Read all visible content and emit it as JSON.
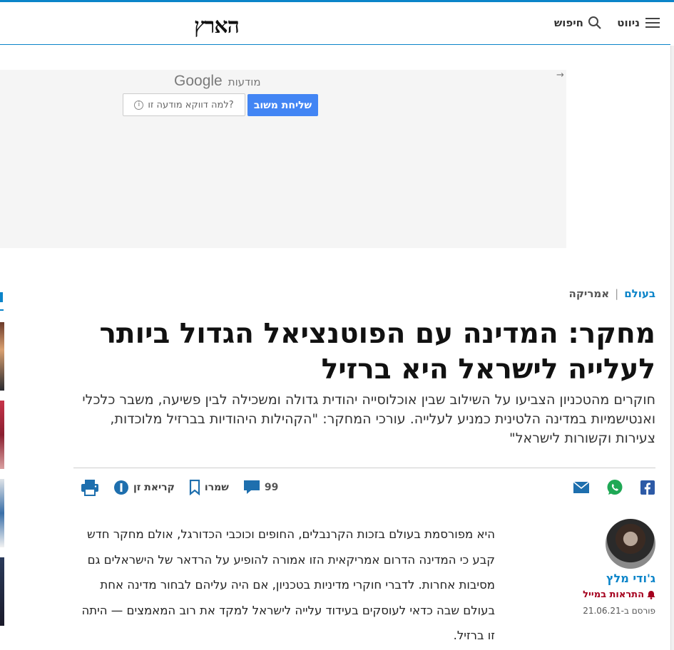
{
  "header": {
    "menu_label": "ניווט",
    "search_label": "חיפוש",
    "logo_text": "הארץ",
    "accent_color": "#0b84c9"
  },
  "ad": {
    "google_label": "Google",
    "ads_label": "מודעות",
    "send_feedback": "שליחת משוב",
    "why_this_ad": "?למה דווקא מודעה זו",
    "arrow_icon": "arrow-right-icon"
  },
  "article": {
    "breadcrumb": [
      "בעולם",
      "אמריקה"
    ],
    "title": "מחקר: המדינה עם הפוטנציאל הגדול ביותר לעלייה לישראל היא ברזיל",
    "subtitle": "חוקרים מהטכניון הצביעו על השילוב שבין אוכלוסייה יהודית גדולה ומשכילה לבין פשיעה, משבר כלכלי ואנטישמיות במדינה הלטינית כמניע לעלייה. עורכי המחקר: \"הקהילות היהודיות בברזיל מלוכדות, צעירות וקשורות לישראל\"",
    "body": "היא מפורסמת בעולם בזכות הקרנבלים, החופים וכוכבי הכדורגל, אולם מחקר חדש קבע כי המדינה הדרום אמריקאית הזו אמורה להופיע על הרדאר של הישראלים גם מסיבות אחרות. לדברי חוקרי מדיניות בטכניון, אם היה עליהם לבחור מדינה אחת בעולם שבה כדאי לעוסקים בעידוד עלייה לישראל למקד את רוב המאמצים — היתה זו ברזיל."
  },
  "toolbar": {
    "comments_count": "99",
    "save_label": "שמרו",
    "zen_label": "קריאת זן",
    "share_icons": [
      "facebook-icon",
      "whatsapp-icon",
      "mail-icon"
    ]
  },
  "author": {
    "name": "ג'ודי מלץ",
    "alerts_label": "התראות במייל",
    "published": "פורסם ב-21.06.21"
  }
}
